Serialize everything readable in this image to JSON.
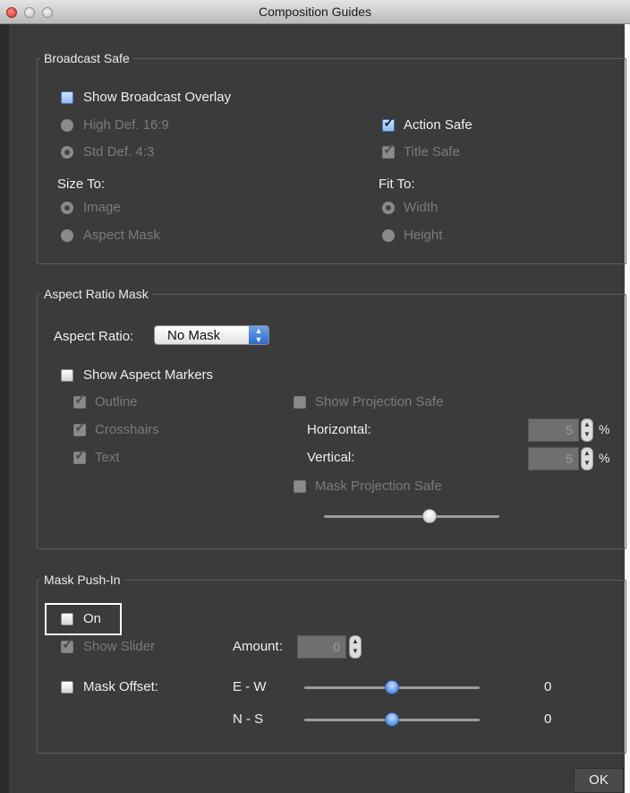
{
  "window": {
    "title": "Composition Guides"
  },
  "broadcast_safe": {
    "legend": "Broadcast Safe",
    "show_overlay": {
      "label": "Show Broadcast Overlay",
      "checked": false
    },
    "high_def": {
      "label": "High Def. 16:9",
      "selected": false
    },
    "std_def": {
      "label": "Std Def. 4:3",
      "selected": true
    },
    "action_safe": {
      "label": "Action Safe",
      "checked": true
    },
    "title_safe": {
      "label": "Title Safe",
      "checked": true
    },
    "size_to": {
      "label": "Size To:",
      "image": "Image",
      "aspect_mask": "Aspect Mask",
      "selected": "Image"
    },
    "fit_to": {
      "label": "Fit To:",
      "width": "Width",
      "height": "Height",
      "selected": "Width"
    }
  },
  "aspect_ratio_mask": {
    "legend": "Aspect Ratio Mask",
    "aspect_ratio_label": "Aspect Ratio:",
    "aspect_ratio_value": "No Mask",
    "show_markers": {
      "label": "Show Aspect Markers",
      "checked": false
    },
    "outline": {
      "label": "Outline",
      "checked": true
    },
    "crosshairs": {
      "label": "Crosshairs",
      "checked": true
    },
    "text": {
      "label": "Text",
      "checked": true
    },
    "show_projection_safe": {
      "label": "Show Projection Safe",
      "checked": false
    },
    "horizontal": {
      "label": "Horizontal:",
      "value": "5",
      "unit": "%"
    },
    "vertical": {
      "label": "Vertical:",
      "value": "5",
      "unit": "%"
    },
    "mask_projection_safe": {
      "label": "Mask Projection Safe",
      "checked": false
    },
    "opacity_slider": {
      "level": 0.6
    }
  },
  "mask_push_in": {
    "legend": "Mask Push-In",
    "on": {
      "label": "On",
      "checked": false
    },
    "show_slider": {
      "label": "Show Slider",
      "checked": true
    },
    "amount": {
      "label": "Amount:",
      "value": "0"
    },
    "mask_offset": {
      "label": "Mask Offset:",
      "checked": false
    },
    "ew": {
      "label": "E - W",
      "value": "0",
      "level": 0.5
    },
    "ns": {
      "label": "N - S",
      "value": "0",
      "level": 0.5
    }
  },
  "ok_label": "OK",
  "colors": {
    "accent_blue": "#2c6bcc",
    "panel_bg": "#3b3b3b",
    "text": "#efefef",
    "disabled_text": "#7b7b7b"
  }
}
